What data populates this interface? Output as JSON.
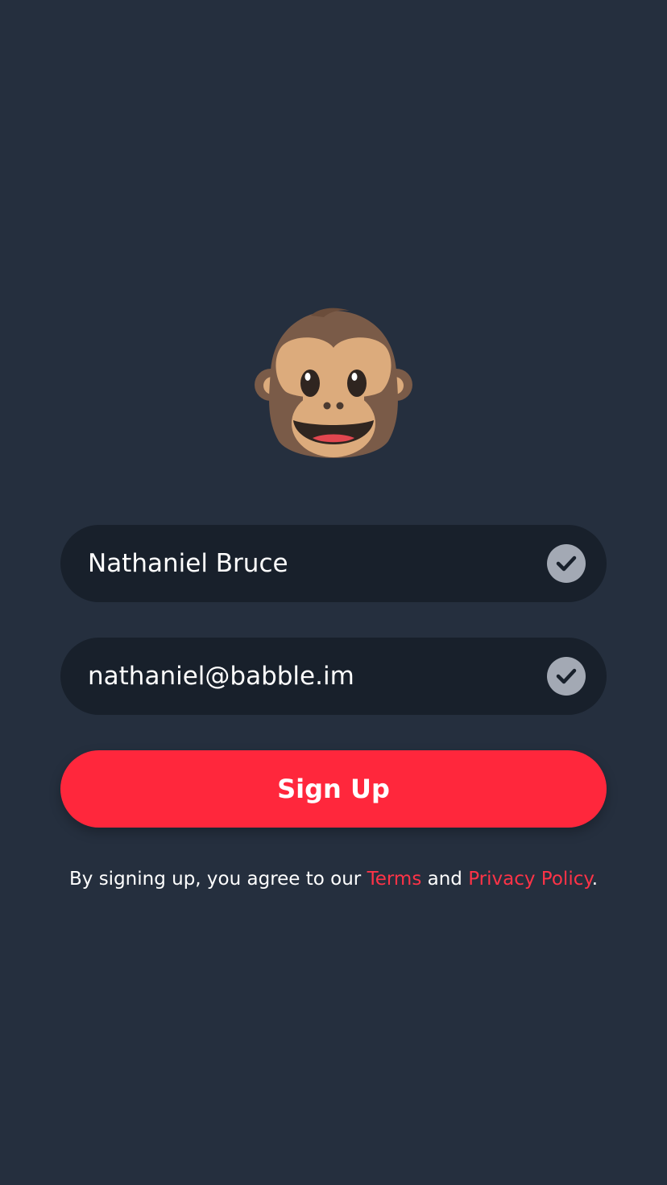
{
  "logo": {
    "icon": "monkey-face-icon"
  },
  "form": {
    "name_value": "Nathaniel Bruce",
    "email_value": "nathaniel@babble.im",
    "valid_icon": "checkmark-icon"
  },
  "signup_label": "Sign Up",
  "terms": {
    "prefix": "By signing up, you agree to our ",
    "terms_link": "Terms",
    "joiner": " and ",
    "privacy_link": "Privacy Policy",
    "suffix": "."
  },
  "colors": {
    "background": "#252f3e",
    "field_background": "#18202b",
    "accent": "#ff273c",
    "check_badge": "#a3a9b4"
  }
}
